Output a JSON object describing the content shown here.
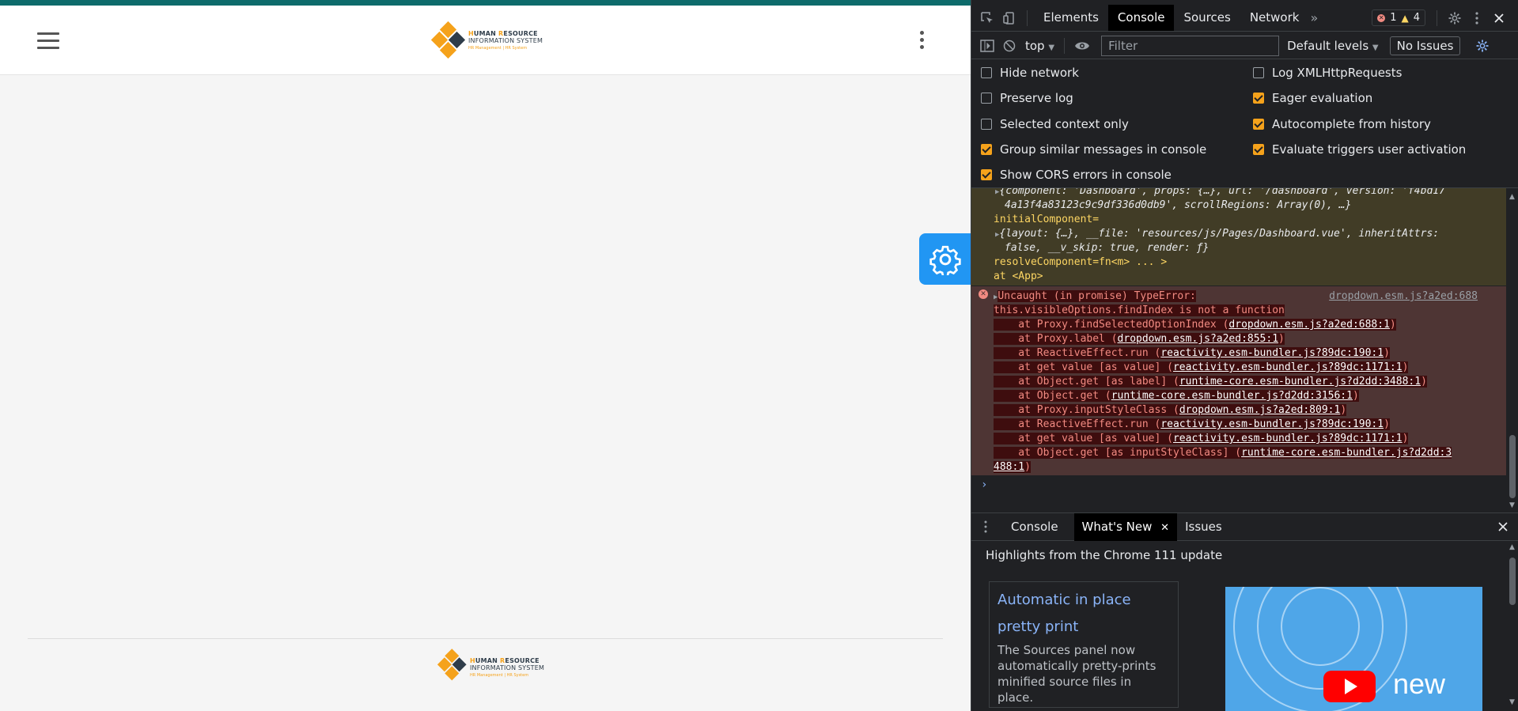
{
  "app": {
    "logo": {
      "line1_first": "H",
      "line1_rest": "UMAN ",
      "line1_second": "R",
      "line1_rest2": "ESOURCE",
      "line2": "INFORMATION SYSTEM",
      "line3": "HR Management | HR System",
      "letters": [
        "R",
        "H",
        "I",
        "S"
      ]
    }
  },
  "devtools": {
    "tabs": [
      "Elements",
      "Console",
      "Sources",
      "Network"
    ],
    "active_tab": "Console",
    "error_count": "1",
    "warning_count": "4",
    "toolbar": {
      "context": "top",
      "filter_placeholder": "Filter",
      "levels": "Default levels",
      "issues": "No Issues"
    },
    "settings": {
      "hide_network": "Hide network",
      "preserve_log": "Preserve log",
      "selected_context": "Selected context only",
      "group_similar": "Group similar messages in console",
      "show_cors": "Show CORS errors in console",
      "log_xhr": "Log XMLHttpRequests",
      "eager_eval": "Eager evaluation",
      "autocomplete": "Autocomplete from history",
      "evaluate_triggers": "Evaluate triggers user activation"
    },
    "warning": {
      "l1": "{component: 'Dashboard', props: {…}, url: '/dashboard', version: 'f4bd17",
      "l2": "4a13f4a83123c9c9df336d0db9', scrollRegions: Array(0), …}",
      "l3": "initialComponent=",
      "l4": "{layout: {…}, __file: 'resources/js/Pages/Dashboard.vue', inheritAttrs:",
      "l5": "false, __v_skip: true, render: ƒ}",
      "l6": "resolveComponent=fn<m>  ... >",
      "l7": "  at <App>"
    },
    "error": {
      "head": "Uncaught (in promise) TypeError:",
      "source": "dropdown.esm.js?a2ed:688",
      "message": "this.visibleOptions.findIndex is not a function",
      "stack": [
        {
          "prefix": "    at Proxy.findSelectedOptionIndex (",
          "link": "dropdown.esm.js?a2ed:688:1",
          "suffix": ")"
        },
        {
          "prefix": "    at Proxy.label (",
          "link": "dropdown.esm.js?a2ed:855:1",
          "suffix": ")"
        },
        {
          "prefix": "    at ReactiveEffect.run (",
          "link": "reactivity.esm-bundler.js?89dc:190:1",
          "suffix": ")"
        },
        {
          "prefix": "    at get value [as value] (",
          "link": "reactivity.esm-bundler.js?89dc:1171:1",
          "suffix": ")"
        },
        {
          "prefix": "    at Object.get [as label] (",
          "link": "runtime-core.esm-bundler.js?d2dd:3488:1",
          "suffix": ")"
        },
        {
          "prefix": "    at Object.get (",
          "link": "runtime-core.esm-bundler.js?d2dd:3156:1",
          "suffix": ")"
        },
        {
          "prefix": "    at Proxy.inputStyleClass (",
          "link": "dropdown.esm.js?a2ed:809:1",
          "suffix": ")"
        },
        {
          "prefix": "    at ReactiveEffect.run (",
          "link": "reactivity.esm-bundler.js?89dc:190:1",
          "suffix": ")"
        },
        {
          "prefix": "    at get value [as value] (",
          "link": "reactivity.esm-bundler.js?89dc:1171:1",
          "suffix": ")"
        },
        {
          "prefix": "    at Object.get [as inputStyleClass] (",
          "link": "runtime-core.esm-bundler.js?d2dd:3",
          "suffix": ""
        }
      ],
      "tail_link": "488:1",
      "tail_suffix": ")"
    },
    "prompt": "›",
    "drawer": {
      "tabs": [
        "Console",
        "What's New",
        "Issues"
      ],
      "active": "What's New",
      "heading": "Highlights from the Chrome 111 update",
      "card_title": "Automatic in place pretty print",
      "card_body": "The Sources panel now automatically pretty-prints minified source files in place.",
      "video_word": "new"
    }
  }
}
